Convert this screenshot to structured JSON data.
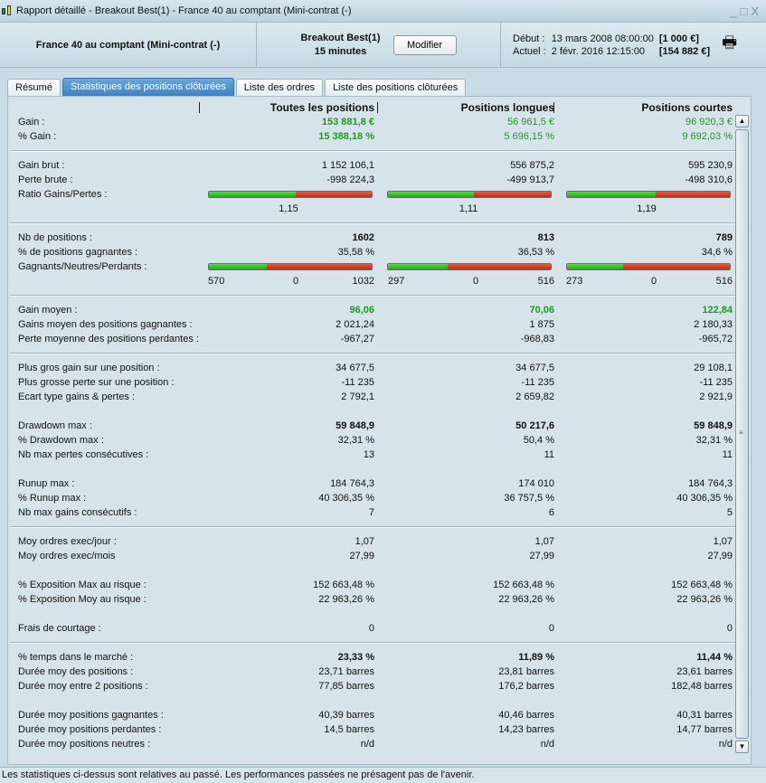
{
  "window": {
    "title": "Rapport détaillé - Breakout Best(1) - France 40 au comptant (Mini-contrat  (-)"
  },
  "header": {
    "instrument": "France 40 au comptant (Mini-contrat  (-)",
    "strategy": "Breakout Best(1)",
    "timeframe": "15 minutes",
    "modify_label": "Modifier",
    "start_label": "Début :",
    "start_date": "13 mars 2008 08:00:00",
    "start_capital": "[1 000 €]",
    "current_label": "Actuel :",
    "current_date": "2 févr. 2016 12:15:00",
    "current_capital": "[154 882 €]"
  },
  "tabs": [
    "Résumé",
    "Statistiques des positions clôturées",
    "Liste des ordres",
    "Liste des positions clôturées"
  ],
  "active_tab": 1,
  "columns": [
    "Toutes les positions",
    "Positions longues",
    "Positions courtes"
  ],
  "colors": {
    "positive": "#1f9a1f",
    "bar_green": "#22a81a",
    "bar_red": "#c22a14"
  },
  "rows": [
    {
      "type": "row",
      "label": "Gain :",
      "values": [
        "153 881,8 €",
        "56 961,5 €",
        "96 920,3 €"
      ],
      "style": [
        "green bold",
        "green",
        "green"
      ]
    },
    {
      "type": "row",
      "label": "% Gain :",
      "values": [
        "15 388,18 %",
        "5 696,15 %",
        "9 692,03 %"
      ],
      "style": [
        "green bold",
        "green",
        "green"
      ]
    },
    {
      "type": "sep"
    },
    {
      "type": "row",
      "label": "Gain brut :",
      "values": [
        "1 152 106,1",
        "556 875,2",
        "595 230,9"
      ]
    },
    {
      "type": "row",
      "label": "Perte brute :",
      "values": [
        "-998 224,3",
        "-499 913,7",
        "-498 310,6"
      ]
    },
    {
      "type": "bar",
      "label": "Ratio Gains/Pertes :",
      "fractions": [
        0.536,
        0.527,
        0.544
      ]
    },
    {
      "type": "center",
      "values": [
        "1,15",
        "1,11",
        "1,19"
      ]
    },
    {
      "type": "sep"
    },
    {
      "type": "row",
      "label": "Nb de positions :",
      "values": [
        "1602",
        "813",
        "789"
      ],
      "style": [
        "bold",
        "bold",
        "bold"
      ]
    },
    {
      "type": "row",
      "label": "% de positions gagnantes :",
      "values": [
        "35,58 %",
        "36,53 %",
        "34,6 %"
      ]
    },
    {
      "type": "bar",
      "label": "Gagnants/Neutres/Perdants :",
      "fractions": [
        0.356,
        0.365,
        0.346
      ]
    },
    {
      "type": "triple",
      "values": [
        [
          "570",
          "0",
          "1032"
        ],
        [
          "297",
          "0",
          "516"
        ],
        [
          "273",
          "0",
          "516"
        ]
      ]
    },
    {
      "type": "sep"
    },
    {
      "type": "row",
      "label": "Gain moyen :",
      "values": [
        "96,06",
        "70,06",
        "122,84"
      ],
      "style": [
        "green bold",
        "green bold",
        "green bold"
      ]
    },
    {
      "type": "row",
      "label": "Gains moyen des positions gagnantes :",
      "values": [
        "2 021,24",
        "1 875",
        "2 180,33"
      ]
    },
    {
      "type": "row",
      "label": "Perte moyenne des positions perdantes :",
      "values": [
        "-967,27",
        "-968,83",
        "-965,72"
      ]
    },
    {
      "type": "sep"
    },
    {
      "type": "row",
      "label": "Plus gros gain sur une position :",
      "values": [
        "34 677,5",
        "34 677,5",
        "29 108,1"
      ]
    },
    {
      "type": "row",
      "label": "Plus grosse perte sur une position :",
      "values": [
        "-11 235",
        "-11 235",
        "-11 235"
      ]
    },
    {
      "type": "row",
      "label": "Ecart type gains & pertes :",
      "values": [
        "2 792,1",
        "2 659,82",
        "2 921,9"
      ]
    },
    {
      "type": "blank"
    },
    {
      "type": "row",
      "label": "Drawdown max :",
      "values": [
        "59 848,9",
        "50 217,6",
        "59 848,9"
      ],
      "style": [
        "bold",
        "bold",
        "bold"
      ]
    },
    {
      "type": "row",
      "label": "% Drawdown max :",
      "values": [
        "32,31 %",
        "50,4 %",
        "32,31 %"
      ]
    },
    {
      "type": "row",
      "label": "Nb max pertes consécutives :",
      "values": [
        "13",
        "11",
        "11"
      ]
    },
    {
      "type": "blank"
    },
    {
      "type": "row",
      "label": "Runup max :",
      "values": [
        "184 764,3",
        "174 010",
        "184 764,3"
      ]
    },
    {
      "type": "row",
      "label": "% Runup max :",
      "values": [
        "40 306,35 %",
        "36 757,5 %",
        "40 306,35 %"
      ]
    },
    {
      "type": "row",
      "label": "Nb max gains consécutifs :",
      "values": [
        "7",
        "6",
        "5"
      ]
    },
    {
      "type": "sep"
    },
    {
      "type": "row",
      "label": "Moy ordres exec/jour :",
      "values": [
        "1,07",
        "1,07",
        "1,07"
      ]
    },
    {
      "type": "row",
      "label": "Moy ordres exec/mois",
      "values": [
        "27,99",
        "27,99",
        "27,99"
      ]
    },
    {
      "type": "blank"
    },
    {
      "type": "row",
      "label": "% Exposition Max au risque :",
      "values": [
        "152 663,48 %",
        "152 663,48 %",
        "152 663,48 %"
      ]
    },
    {
      "type": "row",
      "label": "% Exposition Moy au risque :",
      "values": [
        "22 963,26 %",
        "22 963,26 %",
        "22 963,26 %"
      ]
    },
    {
      "type": "blank"
    },
    {
      "type": "row",
      "label": "Frais de courtage :",
      "values": [
        "0",
        "0",
        "0"
      ]
    },
    {
      "type": "sep"
    },
    {
      "type": "row",
      "label": "% temps dans le marché :",
      "values": [
        "23,33 %",
        "11,89 %",
        "11,44 %"
      ],
      "style": [
        "bold",
        "bold",
        "bold"
      ]
    },
    {
      "type": "row",
      "label": "Durée moy des positions :",
      "values": [
        "23,71 barres",
        "23,81 barres",
        "23,61 barres"
      ]
    },
    {
      "type": "row",
      "label": "Durée moy entre 2 positions :",
      "values": [
        "77,85 barres",
        "176,2 barres",
        "182,48 barres"
      ]
    },
    {
      "type": "blank"
    },
    {
      "type": "row",
      "label": "Durée moy positions gagnantes :",
      "values": [
        "40,39 barres",
        "40,46 barres",
        "40,31 barres"
      ]
    },
    {
      "type": "row",
      "label": "Durée moy positions perdantes :",
      "values": [
        "14,5 barres",
        "14,23 barres",
        "14,77 barres"
      ]
    },
    {
      "type": "row",
      "label": "Durée moy positions neutres :",
      "values": [
        "n/d",
        "n/d",
        "n/d"
      ]
    }
  ],
  "status": "Les statistiques ci-dessus sont relatives au passé. Les performances passées ne présagent pas de l'avenir."
}
